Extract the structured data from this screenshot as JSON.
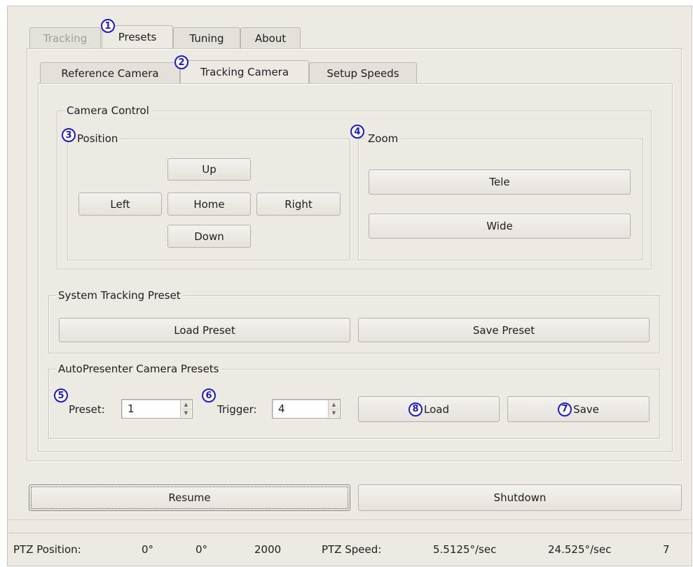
{
  "tabs": [
    {
      "label": "Tracking",
      "state": "disabled"
    },
    {
      "label": "Presets",
      "state": "active"
    },
    {
      "label": "Tuning",
      "state": "normal"
    },
    {
      "label": "About",
      "state": "normal"
    }
  ],
  "subtabs": [
    {
      "label": "Reference Camera",
      "state": "normal"
    },
    {
      "label": "Tracking Camera",
      "state": "active"
    },
    {
      "label": "Setup Speeds",
      "state": "normal"
    }
  ],
  "badges": [
    "1",
    "2",
    "3",
    "4",
    "5",
    "6",
    "7",
    "8"
  ],
  "camera_control": {
    "title": "Camera Control",
    "position": {
      "title": "Position",
      "up": "Up",
      "left": "Left",
      "home": "Home",
      "right": "Right",
      "down": "Down"
    },
    "zoom": {
      "title": "Zoom",
      "tele": "Tele",
      "wide": "Wide"
    }
  },
  "system_preset": {
    "title": "System Tracking Preset",
    "load": "Load Preset",
    "save": "Save Preset"
  },
  "autopresenter": {
    "title": "AutoPresenter Camera Presets",
    "preset_label": "Preset:",
    "preset_value": "1",
    "trigger_label": "Trigger:",
    "trigger_value": "4",
    "load": "Load",
    "save": "Save"
  },
  "bottom": {
    "resume": "Resume",
    "shutdown": "Shutdown"
  },
  "status": {
    "ptz_position_label": "PTZ Position:",
    "pan": "0°",
    "tilt": "0°",
    "zoom": "2000",
    "ptz_speed_label": "PTZ Speed:",
    "pan_speed": "5.5125°/sec",
    "tilt_speed": "24.525°/sec",
    "count": "7"
  },
  "colors": {
    "badge": "#1a1ad8",
    "window_bg": "#ede9e3"
  }
}
